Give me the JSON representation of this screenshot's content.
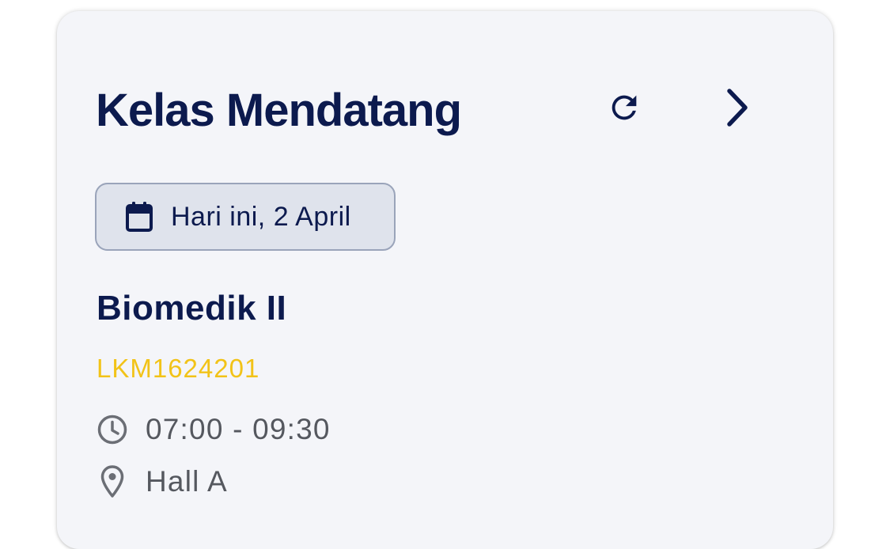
{
  "card": {
    "title": "Kelas Mendatang",
    "refresh_icon": "refresh-icon",
    "next_icon": "chevron-right-icon",
    "date_chip": {
      "icon": "calendar-icon",
      "label": "Hari ini, 2 April"
    },
    "class": {
      "name": "Biomedik II",
      "code": "LKM1624201",
      "time": "07:00 - 09:30",
      "time_icon": "clock-icon",
      "location": "Hall A",
      "location_icon": "location-pin-icon"
    }
  },
  "colors": {
    "card_background": "#f4f5f9",
    "navy": "#0c1a4e",
    "code_yellow": "#f2c318",
    "chip_background": "#dfe3ec",
    "chip_border": "#9aa4ba",
    "meta_gray": "#55585f"
  }
}
